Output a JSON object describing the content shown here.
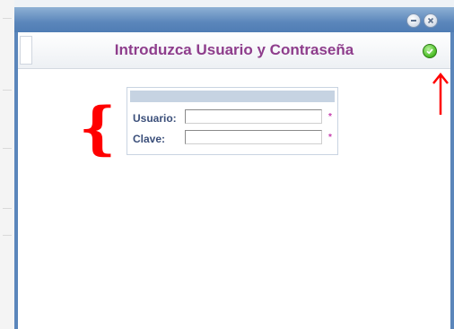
{
  "window": {
    "title": "Introduzca Usuario y Contraseña",
    "buttons": [
      "minimize-icon",
      "close-icon"
    ],
    "confirm_icon": "check-circle-icon"
  },
  "login_form": {
    "fields": [
      {
        "label": "Usuario:",
        "value": "",
        "required_mark": "*"
      },
      {
        "label": "Clave:",
        "value": "",
        "required_mark": "*"
      }
    ]
  },
  "annotations": {
    "brace": "{",
    "color": "#ff0000"
  },
  "colors": {
    "title_text": "#8e3d8c",
    "field_label": "#3b4f7a",
    "required_mark": "#c63fae",
    "titlebar": "#5b86bb",
    "confirm": "#4fbf2a"
  }
}
